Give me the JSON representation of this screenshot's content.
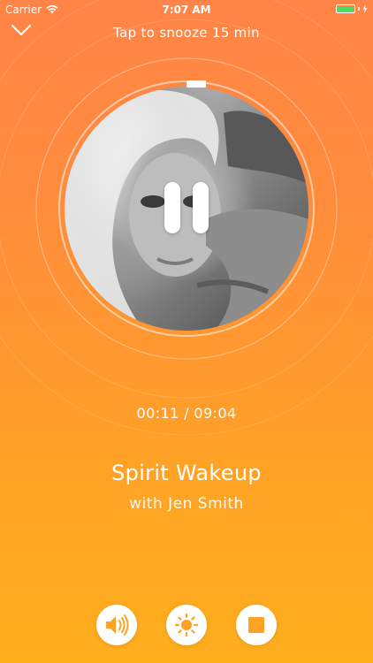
{
  "status_bar": {
    "carrier": "Carrier",
    "time": "7:07 AM"
  },
  "header": {
    "dismiss_icon": "chevron-down-icon",
    "snooze_label": "Tap to snooze 15 min"
  },
  "player": {
    "state_icon": "pause-icon",
    "elapsed_time": "00:11",
    "separator": "/",
    "total_time": "09:04",
    "timecode": "00:11 / 09:04",
    "progress": 0.02
  },
  "track": {
    "title": "Spirit Wakeup",
    "subtitle": "with Jen Smith"
  },
  "controls": [
    {
      "name": "volume-button",
      "icon": "speaker-icon"
    },
    {
      "name": "brightness-button",
      "icon": "sun-icon"
    },
    {
      "name": "stop-button",
      "icon": "stop-icon"
    }
  ],
  "colors": {
    "gradient_top": "#FF8447",
    "gradient_bottom": "#FFAE1C",
    "accent": "#FFA124",
    "battery": "#4CD964"
  }
}
